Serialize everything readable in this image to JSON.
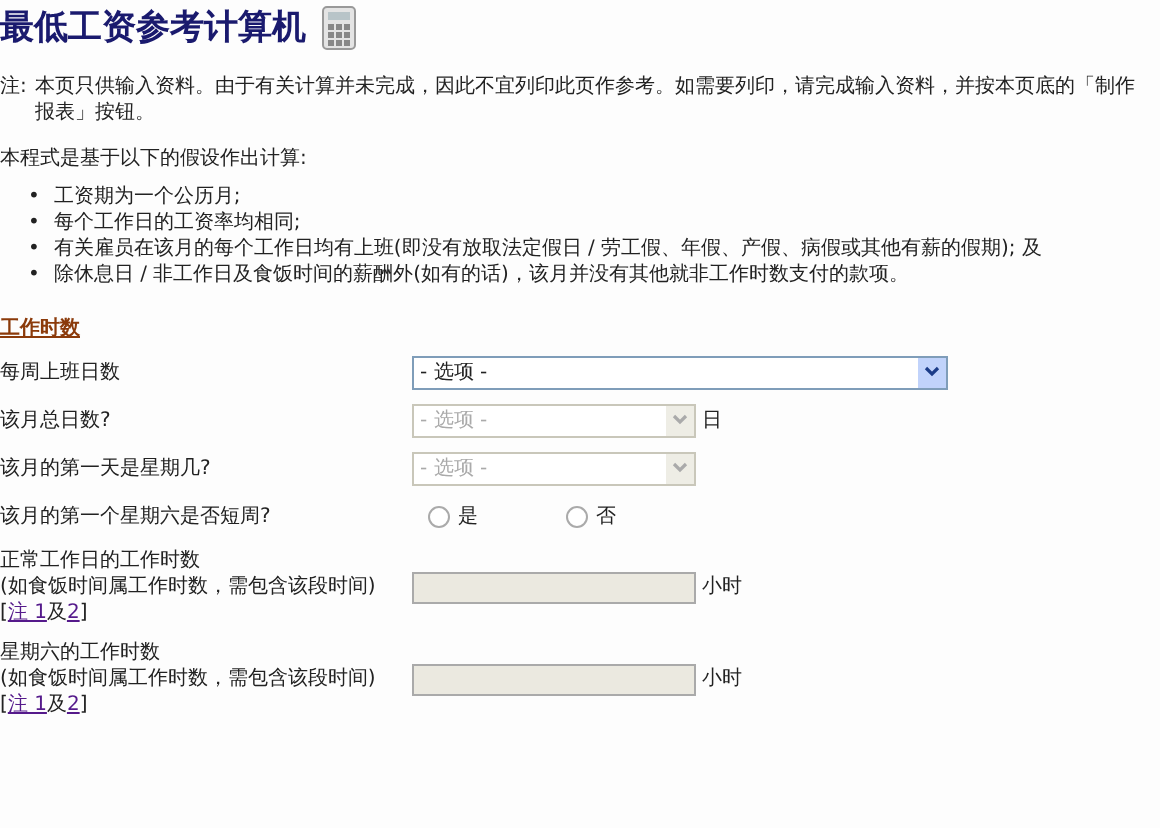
{
  "title": "最低工资参考计算机",
  "note": {
    "label": "注:",
    "text": "本页只供输入资料。由于有关计算并未完成，因此不宜列印此页作参考。如需要列印，请完成输入资料，并按本页底的「制作报表」按钮。"
  },
  "intro": "本程式是基于以下的假设作出计算:",
  "assumptions": [
    {
      "bullet": "•",
      "text": "工资期为一个公历月;"
    },
    {
      "bullet": "•",
      "text": "每个工作日的工资率均相同;"
    },
    {
      "bullet": "•",
      "text": "有关雇员在该月的每个工作日均有上班(即没有放取法定假日 / 劳工假、年假、产假、病假或其他有薪的假期); 及"
    },
    {
      "bullet": "•",
      "text": "除休息日 / 非工作日及食饭时间的薪酬外(如有的话)，该月并没有其他就非工作时数支付的款项。"
    }
  ],
  "section": "工作时数",
  "fields": [
    {
      "kind": "select",
      "label": "每周上班日数",
      "value": "- 选项 -",
      "disabled": false,
      "wide": true
    },
    {
      "kind": "select",
      "label": "该月总日数?",
      "value": "- 选项 -",
      "disabled": true,
      "unit": "日"
    },
    {
      "kind": "select",
      "label": "该月的第一天是星期几?",
      "value": "- 选项 -",
      "disabled": true
    },
    {
      "kind": "radio",
      "label": "该月的第一个星期六是否短周?",
      "options": [
        {
          "label": "是",
          "selected": false
        },
        {
          "label": "否",
          "selected": false
        }
      ]
    },
    {
      "kind": "text",
      "label": "正常工作日的工作时数",
      "hint": "(如食饭时间属工作时数，需包含该段时间)",
      "notes": {
        "open": "[",
        "first": "注 1",
        "join": "及",
        "second": "2",
        "close": "]"
      },
      "disabled": true,
      "unit": "小时"
    },
    {
      "kind": "text",
      "label": "星期六的工作时数",
      "hint": "(如食饭时间属工作时数，需包含该段时间)",
      "notes": {
        "open": "[",
        "first": "注 1",
        "join": "及",
        "second": "2",
        "close": "]"
      },
      "disabled": true,
      "unit": "小时"
    }
  ]
}
